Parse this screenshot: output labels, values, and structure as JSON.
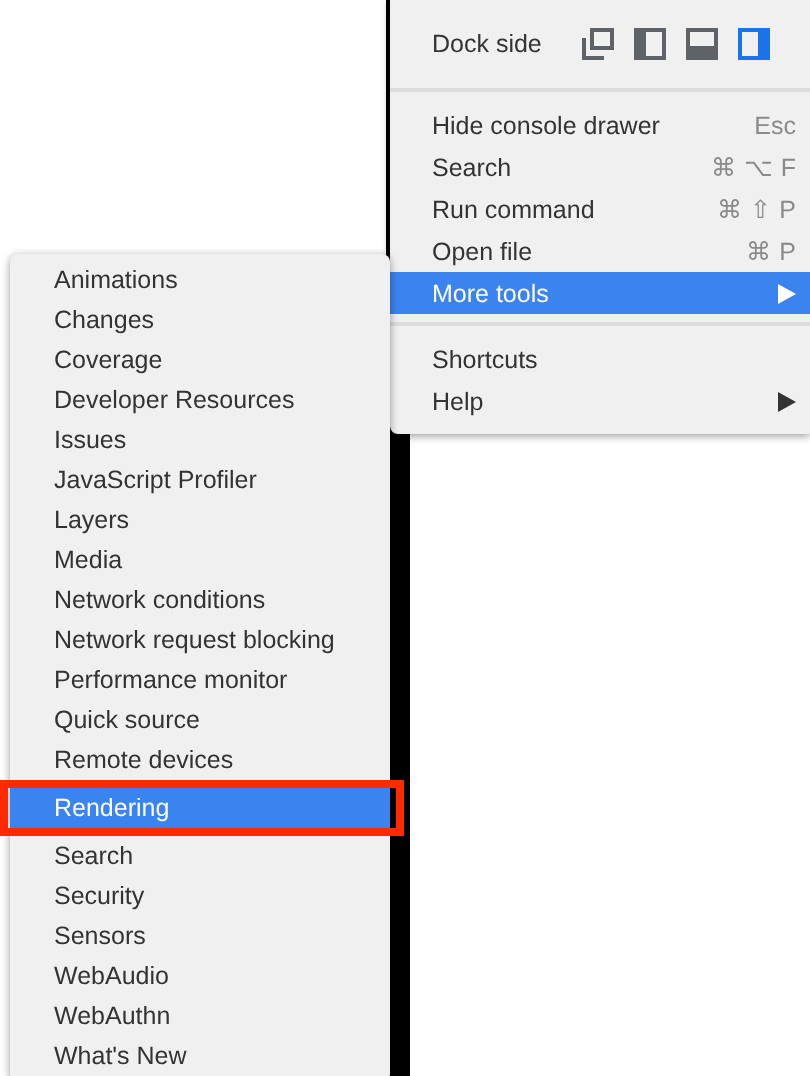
{
  "main_menu": {
    "dock_side": {
      "label": "Dock side",
      "options": [
        {
          "kind": "undock",
          "selected": false
        },
        {
          "kind": "left",
          "selected": false
        },
        {
          "kind": "bottom",
          "selected": false
        },
        {
          "kind": "right",
          "selected": true
        }
      ]
    },
    "groups": [
      [
        {
          "label": "Hide console drawer",
          "shortcut": "Esc",
          "kind": "item",
          "selected": false
        },
        {
          "label": "Search",
          "shortcut": "⌘ ⌥ F",
          "kind": "item",
          "selected": false
        },
        {
          "label": "Run command",
          "shortcut": "⌘ ⇧ P",
          "kind": "item",
          "selected": false
        },
        {
          "label": "Open file",
          "shortcut": "⌘ P",
          "kind": "item",
          "selected": false
        },
        {
          "label": "More tools",
          "kind": "submenu",
          "selected": true
        }
      ],
      [
        {
          "label": "Shortcuts",
          "kind": "item",
          "selected": false
        },
        {
          "label": "Help",
          "kind": "submenu",
          "selected": false
        }
      ]
    ]
  },
  "more_tools_menu": {
    "items": [
      {
        "label": "Animations",
        "selected": false
      },
      {
        "label": "Changes",
        "selected": false
      },
      {
        "label": "Coverage",
        "selected": false
      },
      {
        "label": "Developer Resources",
        "selected": false
      },
      {
        "label": "Issues",
        "selected": false
      },
      {
        "label": "JavaScript Profiler",
        "selected": false
      },
      {
        "label": "Layers",
        "selected": false
      },
      {
        "label": "Media",
        "selected": false
      },
      {
        "label": "Network conditions",
        "selected": false
      },
      {
        "label": "Network request blocking",
        "selected": false
      },
      {
        "label": "Performance monitor",
        "selected": false
      },
      {
        "label": "Quick source",
        "selected": false
      },
      {
        "label": "Remote devices",
        "selected": false
      },
      {
        "label": "Rendering",
        "selected": true
      },
      {
        "label": "Search",
        "selected": false
      },
      {
        "label": "Security",
        "selected": false
      },
      {
        "label": "Sensors",
        "selected": false
      },
      {
        "label": "WebAudio",
        "selected": false
      },
      {
        "label": "WebAuthn",
        "selected": false
      },
      {
        "label": "What's New",
        "selected": false
      }
    ]
  }
}
